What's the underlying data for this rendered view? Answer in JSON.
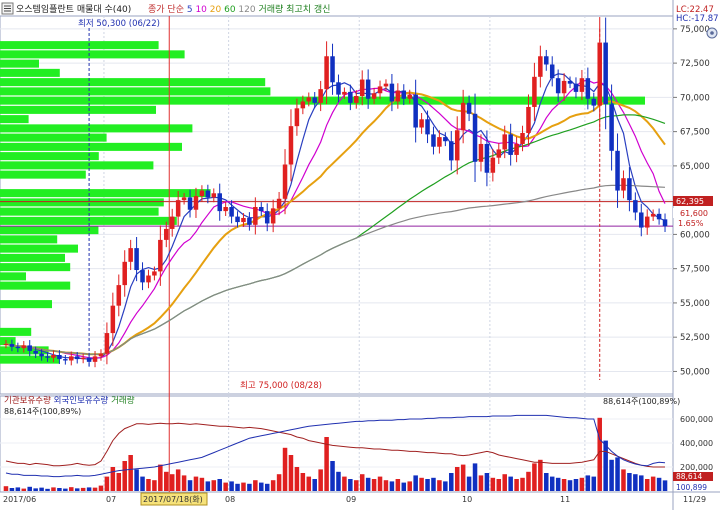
{
  "header": {
    "title": "오스템임플란트 매물대 수(40)",
    "indicator_labels": [
      {
        "text": "종가 단순",
        "color": "#c03030"
      },
      {
        "text": "5",
        "color": "#2a3fc0"
      },
      {
        "text": "10",
        "color": "#d000d0"
      },
      {
        "text": "20",
        "color": "#e6a010"
      },
      {
        "text": "60",
        "color": "#20a020"
      },
      {
        "text": "120",
        "color": "#888888"
      },
      {
        "text": "거래량 최고치 갱신",
        "color": "#208020"
      }
    ],
    "lc_label": "LC:22.47",
    "hc_label": "HC:-17.87"
  },
  "annotations": {
    "low_label": "최저 50,300 (06/22)",
    "high_label": "최고 75,000 (08/28)",
    "current_price_badge": "62,395",
    "last_price_badge": "61,600",
    "change_badge": "1.65%",
    "volume_max_label": "88,614주(100,89%)",
    "volume_left_label": "88,614주(100,89%)",
    "volume_last_badge": "88,614",
    "volume_last_badge2": "100,899"
  },
  "legend_lower": [
    {
      "text": "기관보유수량",
      "color": "#a02020"
    },
    {
      "text": "외국인보유수량",
      "color": "#2030b0"
    },
    {
      "text": "거래량",
      "color": "#208020"
    }
  ],
  "x_axis": {
    "labels": [
      "2017/06",
      "07",
      "2017/07/18(화)",
      "08",
      "09",
      "10",
      "11",
      "11/29"
    ]
  },
  "colors": {
    "up": "#e02020",
    "down": "#1030c0",
    "volume_profile": "#22ee22",
    "ma5": "#2a3fc0",
    "ma10": "#d000d0",
    "ma20": "#e6a010",
    "ma60": "#20a020",
    "ma120": "#888888",
    "inst": "#a02020",
    "foreign": "#2030b0"
  },
  "chart_data": [
    {
      "type": "candlestick",
      "title": "오스템임플란트",
      "ylim": [
        48500,
        75500
      ],
      "y_ticks": [
        50000,
        52500,
        55000,
        57500,
        60000,
        62500,
        65000,
        67500,
        70000,
        72500,
        75000
      ],
      "y_tick_labels": [
        "50,000",
        "52,500",
        "55,000",
        "57,500",
        "60,000",
        "62,500",
        "65,000",
        "67,500",
        "70,000",
        "72,500",
        "75,000"
      ],
      "close": [
        52000,
        51800,
        51700,
        51900,
        51500,
        51300,
        51100,
        51000,
        51200,
        50900,
        50800,
        51100,
        50900,
        51000,
        50700,
        51100,
        51300,
        52800,
        54800,
        56300,
        58000,
        59000,
        57400,
        56500,
        57000,
        57300,
        59600,
        60400,
        61300,
        62500,
        62700,
        61800,
        62800,
        63200,
        62700,
        63000,
        61700,
        62000,
        61300,
        60900,
        61200,
        60700,
        62000,
        61700,
        60800,
        61900,
        62600,
        65100,
        67900,
        69200,
        69700,
        70000,
        69600,
        70600,
        73000,
        71100,
        70200,
        70400,
        69600,
        70100,
        71300,
        69900,
        70300,
        70800,
        71000,
        69700,
        70500,
        69900,
        70200,
        67800,
        68400,
        67300,
        66400,
        67100,
        66800,
        65400,
        67600,
        69600,
        68800,
        65300,
        66600,
        64500,
        65600,
        66200,
        67300,
        65800,
        66600,
        67400,
        69300,
        71500,
        73000,
        72400,
        71400,
        70300,
        71200,
        71000,
        70400,
        71400,
        69900,
        69400,
        74000,
        69500,
        66100,
        63200,
        64100,
        62500,
        61600,
        60500,
        61300,
        61500,
        61100,
        60600
      ],
      "ma_series": [
        "5",
        "10",
        "20",
        "60",
        "120"
      ],
      "volume_profile": {
        "bins": 40,
        "highlight_price": 70000
      }
    },
    {
      "type": "bar",
      "title": "거래량",
      "ylim": [
        0,
        700000
      ],
      "y_ticks": [
        200000,
        400000,
        600000
      ],
      "y_tick_labels": [
        "200,000",
        "400,000",
        "600,000"
      ],
      "volume": [
        40000,
        25000,
        30000,
        20000,
        35000,
        22000,
        28000,
        18000,
        30000,
        25000,
        20000,
        32000,
        22000,
        26000,
        30000,
        28000,
        45000,
        120000,
        200000,
        150000,
        250000,
        300000,
        180000,
        120000,
        100000,
        90000,
        220000,
        160000,
        140000,
        180000,
        130000,
        90000,
        120000,
        110000,
        80000,
        90000,
        100000,
        70000,
        80000,
        60000,
        70000,
        60000,
        90000,
        70000,
        60000,
        90000,
        140000,
        360000,
        300000,
        200000,
        150000,
        120000,
        100000,
        180000,
        450000,
        250000,
        160000,
        120000,
        100000,
        90000,
        140000,
        110000,
        100000,
        120000,
        90000,
        80000,
        100000,
        70000,
        80000,
        130000,
        110000,
        100000,
        110000,
        90000,
        80000,
        150000,
        200000,
        220000,
        120000,
        230000,
        130000,
        150000,
        110000,
        100000,
        140000,
        120000,
        100000,
        110000,
        160000,
        230000,
        260000,
        150000,
        120000,
        110000,
        100000,
        90000,
        100000,
        110000,
        130000,
        120000,
        610000,
        420000,
        260000,
        280000,
        180000,
        150000,
        140000,
        130000,
        100000,
        120000,
        110000,
        88614
      ],
      "institution_holdings": [
        250000,
        240000,
        230000,
        230000,
        220000,
        230000,
        225000,
        220000,
        210000,
        210000,
        215000,
        220000,
        230000,
        220000,
        215000,
        220000,
        250000,
        330000,
        420000,
        480000,
        520000,
        540000,
        560000,
        560000,
        555000,
        560000,
        565000,
        560000,
        560000,
        565000,
        560000,
        555000,
        560000,
        555000,
        550000,
        545000,
        540000,
        540000,
        535000,
        530000,
        525000,
        530000,
        525000,
        520000,
        510000,
        500000,
        490000,
        480000,
        470000,
        450000,
        440000,
        420000,
        410000,
        400000,
        390000,
        380000,
        375000,
        370000,
        365000,
        360000,
        360000,
        355000,
        350000,
        350000,
        345000,
        340000,
        340000,
        335000,
        330000,
        330000,
        325000,
        320000,
        320000,
        315000,
        310000,
        310000,
        300000,
        295000,
        300000,
        310000,
        320000,
        330000,
        320000,
        300000,
        290000,
        280000,
        270000,
        260000,
        250000,
        240000,
        240000,
        235000,
        230000,
        230000,
        230000,
        230000,
        235000,
        240000,
        250000,
        260000,
        330000,
        330000,
        310000,
        290000,
        270000,
        250000,
        230000,
        215000,
        205000,
        200000,
        200000,
        200000
      ],
      "foreign_holdings": [
        150000,
        140000,
        140000,
        130000,
        130000,
        130000,
        125000,
        125000,
        120000,
        120000,
        125000,
        125000,
        130000,
        125000,
        125000,
        130000,
        140000,
        150000,
        160000,
        170000,
        175000,
        180000,
        185000,
        190000,
        195000,
        200000,
        210000,
        220000,
        230000,
        240000,
        250000,
        260000,
        270000,
        280000,
        300000,
        320000,
        340000,
        360000,
        380000,
        400000,
        420000,
        440000,
        450000,
        460000,
        470000,
        480000,
        490000,
        500000,
        510000,
        520000,
        530000,
        540000,
        545000,
        550000,
        555000,
        560000,
        565000,
        570000,
        575000,
        580000,
        580000,
        585000,
        585000,
        590000,
        590000,
        590000,
        595000,
        595000,
        600000,
        600000,
        600000,
        605000,
        605000,
        610000,
        610000,
        610000,
        615000,
        615000,
        620000,
        620000,
        620000,
        620000,
        625000,
        625000,
        625000,
        625000,
        630000,
        630000,
        630000,
        630000,
        630000,
        630000,
        625000,
        620000,
        615000,
        610000,
        610000,
        605000,
        600000,
        600000,
        430000,
        380000,
        330000,
        290000,
        260000,
        240000,
        225000,
        215000,
        210000,
        230000,
        240000,
        235000
      ]
    }
  ]
}
